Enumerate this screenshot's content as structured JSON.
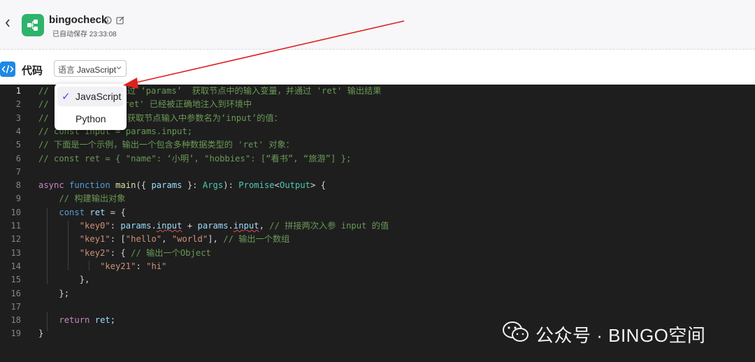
{
  "header": {
    "back_icon": "chevron-left-icon",
    "app_name": "bingocheck",
    "saved_status": "已自动保存 23:33:08"
  },
  "toolbar": {
    "title": "代码",
    "language_prefix": "语言",
    "language_value": "JavaScript"
  },
  "dropdown": {
    "options": [
      "JavaScript",
      "Python"
    ],
    "selected": "JavaScript"
  },
  "editor": {
    "line_numbers": [
      "1",
      "2",
      "3",
      "4",
      "5",
      "6",
      "7",
      "8",
      "9",
      "10",
      "11",
      "12",
      "13",
      "14",
      "15",
      "16",
      "17",
      "18",
      "19"
    ],
    "lines": [
      "//  在这里，您可以通过 ‘params’  获取节点中的输入变量，并通过 'ret' 输出结果",
      "//  'params' 和 'ret' 已经被正确地注入到环境中",
      "//  下面是一个示例，获取节点输入中参数名为‘input’的值：",
      "// const input = params.input;",
      "// 下面是一个示例，输出一个包含多种数据类型的 'ret' 对象：",
      "// const ret = { \"name\": ‘小明’, \"hobbies\": [“看书”, “旅游”] };",
      "",
      "async function main({ params }: Args): Promise<Output> {",
      "    // 构建输出对象",
      "    const ret = {",
      "        \"key0\": params.input + params.input, // 拼接两次入参 input 的值",
      "        \"key1\": [\"hello\", \"world\"], // 输出一个数组",
      "        \"key2\": { // 输出一个Object",
      "            \"key21\": \"hi\"",
      "        },",
      "    };",
      "",
      "    return ret;",
      "}"
    ]
  },
  "watermark": {
    "text": "公众号 · BINGO空间"
  },
  "colors": {
    "brand_green": "#2fb36c",
    "arrow_red": "#e02020",
    "editor_bg": "#1e1e1e",
    "check_blue": "#3b4cf0"
  }
}
